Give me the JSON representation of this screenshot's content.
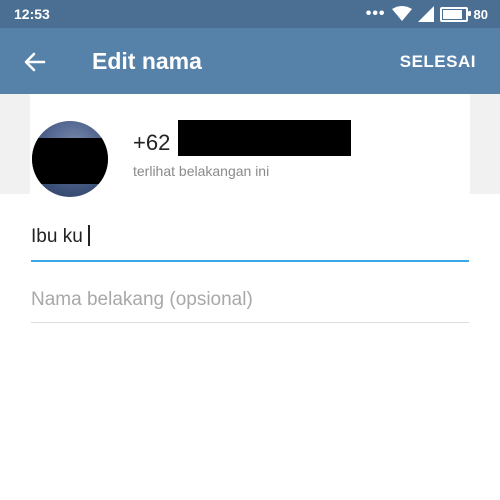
{
  "status_bar": {
    "time": "12:53",
    "battery": "80",
    "battery_level": 0.8
  },
  "app_bar": {
    "title": "Edit nama",
    "done_label": "SELESAI"
  },
  "contact": {
    "phone_prefix": "+62",
    "last_seen": "terlihat belakangan ini"
  },
  "form": {
    "first_name_value": "Ibu ku",
    "last_name_placeholder": "Nama belakang (opsional)"
  },
  "colors": {
    "status_bar": "#4a6f93",
    "app_bar": "#5681a9",
    "accent": "#3aa8e6"
  },
  "icons": {
    "back": "arrow-left-icon",
    "wifi": "wifi-icon",
    "signal": "signal-icon",
    "battery": "battery-icon"
  }
}
